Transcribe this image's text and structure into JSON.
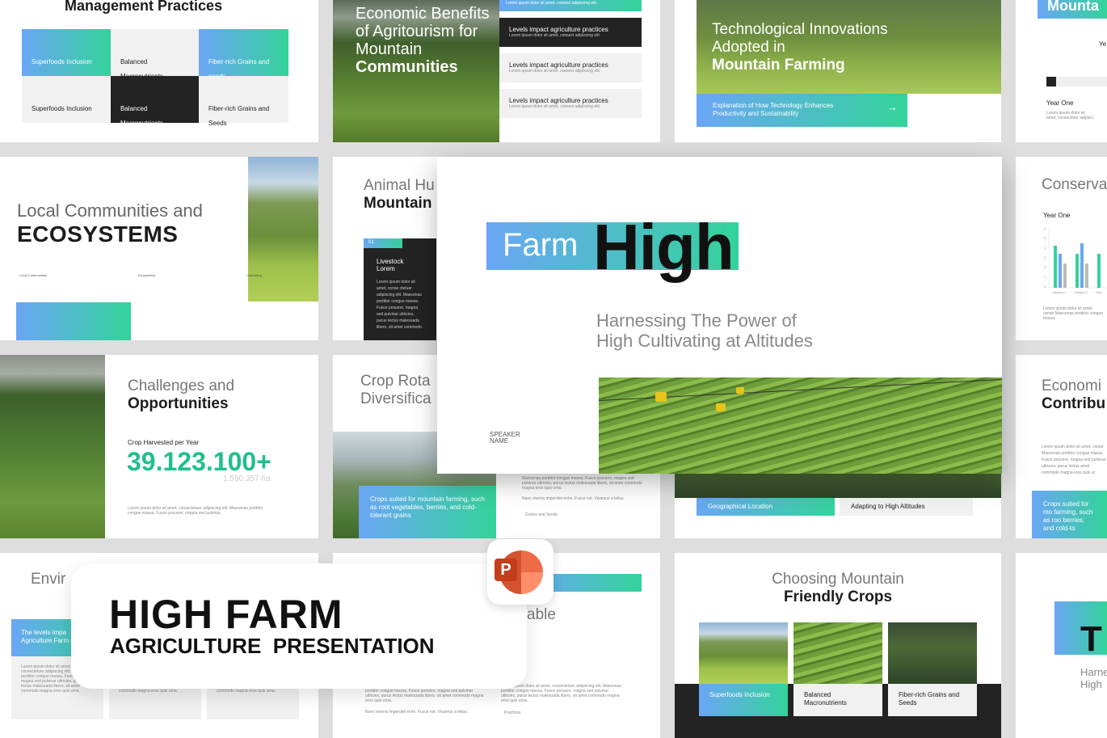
{
  "slides": {
    "mgmt": {
      "title": "Management Practices",
      "cells": [
        "Superfoods Inclusion",
        "Balanced Macronutrients",
        "Fiber-rich Grains and seeds",
        "Superfoods Inclusion",
        "Balanced Macronutrients",
        "Fiber-rich Grains and Seeds"
      ]
    },
    "econ": {
      "title_light": "Economic Benefits of Agritourism for Mountain",
      "title_bold": "Communities",
      "items": [
        {
          "title": "Levels impact agriculture practices",
          "body": "Lorem ipsum dolor sit amet, consect adipiscing elit."
        },
        {
          "title": "Levels impact agriculture practices",
          "body": "Lorem ipsum dolor sit amet, consect adipiscing elit."
        },
        {
          "title": "Levels impact agriculture practices",
          "body": "Lorem ipsum dolor sit amet, consect adipiscing elit."
        }
      ],
      "top_strip": "Lorem ipsum dolor sit amet, consect adipiscing elit."
    },
    "tech": {
      "title_light": "Technological Innovations Adopted in",
      "title_bold": "Mountain Farming",
      "button": "Explanation of How Technology Enhances Productivity and Sustainability",
      "arrow": "→"
    },
    "mount": {
      "title": "Mounta",
      "label": "Year One",
      "sub": "Ye",
      "body": "Lorem ipsum dolor sit amet, consectetur adipisci."
    },
    "local": {
      "title_light": "Local Communities and",
      "title_bold": "ECOSYSTEMS",
      "tags": [
        "Local Communities",
        "Ecosystems",
        "Cultivating"
      ]
    },
    "animal": {
      "title_light": "Animal Hu",
      "title_bold": "Mountain",
      "badge": "01",
      "card_title": "Livestock Lorem",
      "card_body": "Lorem ipsum dolor sit amet, conse ctetuer adipiscing elit. Maecenas porttitor congue massa. Fusce posuere, magna sed pulvinar ultricies, purus lectus malesuada libero, sit amet commodo."
    },
    "conserv": {
      "title": "Conserva",
      "label": "Year One",
      "y_ticks": [
        "6",
        "5",
        "4",
        "3",
        "2",
        "1",
        "0"
      ],
      "categories": [
        "Category 1",
        "Category 2",
        "Cate"
      ],
      "body": "Lorem ipsum dolor sit amet, conse Maecenas porttitor congue massa"
    },
    "challenges": {
      "title_light": "Challenges and",
      "title_bold": "Opportunities",
      "label": "Crop Harvested per Year",
      "number": "39.123.100+",
      "sub": "1.590.357 ha",
      "body": "Lorem ipsum dolor sit amet, consectetuer adipiscing elit. Maecenas porttitor congue massa. Fusce posuere, magna sed pulvinar."
    },
    "crop": {
      "title_light": "Crop Rota",
      "title_light2": "Diversifica",
      "caption": "Crops suited for mountain farming, such as root vegetables, berries, and cold-tolerant grains",
      "body": "Maecenas porttitor congue massa. Fusce posuere, magna sed pulvinar ultricies, purus lectus malesuada libero, sit amet commodo magna eros quis urna.",
      "body2": "Nunc viverra imperdiet enim. Fusce est. Vivamus a tellus.",
      "tag": "Grains and Seeds"
    },
    "geo": {
      "items": [
        "Geographical Location",
        "Adapting to High Altitudes"
      ]
    },
    "econ2": {
      "title_light": "Economi",
      "title_bold": "Contribu",
      "body": "Lorem ipsum dolor sit amet, conse Maecenas porttitor congue massa Fusce posuere, magna sed pulvinar ultricies, purus lectus amet commodo magna eros quis ur",
      "caption": "Crops suited for mo farming, such as roo berries, and cold-to"
    },
    "env": {
      "title": "Envir",
      "caption": "The levels impa Agriculture Farm",
      "body": "Lorem ipsum dolor sit amet, consectetuer adipiscing elit. Maecenas porttitor congue massa. Fusce posuere, magna sed pulvinar ultricies, purus lectus malesuada libero, sit amet commodo magna eros quis urna."
    },
    "table": {
      "title": "able",
      "body": "Lorem ipsum dolor sit amet, consectetuer adipiscing elit. Maecenas porttitor congue massa. Fusce posuere, magna sed pulvinar ultricies, purus lectus malesuada libero, sit amet commodo magna eros quis urna.",
      "body2": "Nunc viverra imperdiet enim. Fusce est. Vivamus a tellus.",
      "tag": "Practices"
    },
    "choosing": {
      "title_light": "Choosing Mountain",
      "title_bold": "Friendly Crops",
      "items": [
        "Superfoods Inclusion",
        "Balanced Macronutrients",
        "Fiber-rich Grains and Seeds"
      ]
    },
    "thumb_right": {
      "title": "T",
      "sub": "Harne High"
    }
  },
  "hero": {
    "farm": "Farm",
    "high": "High",
    "subtitle_line1": "Harnessing The Power of",
    "subtitle_line2": "High Cultivating at Altitudes",
    "speaker": "SPEAKER NAME"
  },
  "banner": {
    "title": "HIGH FARM",
    "subtitle": "AGRICULTURE  PRESENTATION",
    "app_icon": "powerpoint-icon",
    "app_letter": "P"
  },
  "colors": {
    "accent_blue": "#6aa6f5",
    "accent_green": "#33d39a",
    "dark": "#232323",
    "powerpoint": "#d24726"
  }
}
